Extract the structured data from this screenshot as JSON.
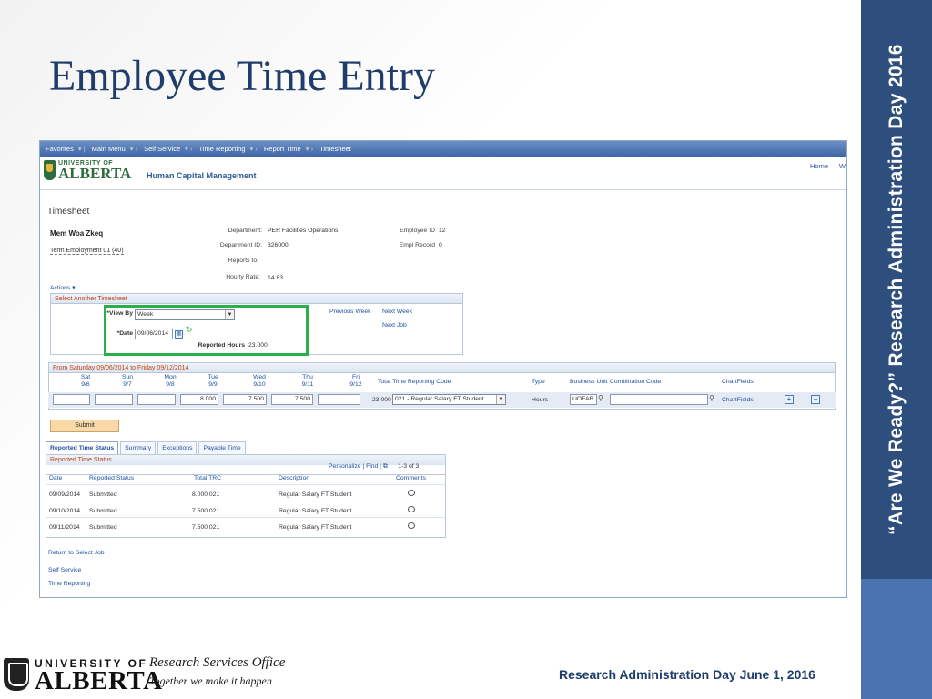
{
  "slide": {
    "title": "Employee Time Entry",
    "sidebar_text": "“Are We Ready?” Research Administration Day 2016",
    "footer_office": "Research Services Office",
    "footer_tagline": "Together we make it happen",
    "footer_event": "Research Administration Day June 1, 2016",
    "footer_logo_top": "UNIVERSITY OF",
    "footer_logo_bottom": "ALBERTA"
  },
  "nav": {
    "items": [
      "Favorites",
      "Main Menu",
      "Self Service",
      "Time Reporting",
      "Report Time",
      "Timesheet"
    ]
  },
  "banner": {
    "logo_top": "UNIVERSITY OF",
    "logo_bottom": "ALBERTA",
    "app_name": "Human Capital Management",
    "home": "Home",
    "w": "W"
  },
  "timesheet": {
    "title": "Timesheet",
    "employee_name": "Mem Woa Zkeq",
    "job": "Term Employment 01 (40)",
    "department_label": "Department:",
    "department_value": "PER Facilities Operations",
    "department_id_label": "Department ID:",
    "department_id_value": "326000",
    "reports_to_label": "Reports to:",
    "reports_to_value": "",
    "hourly_rate_label": "Hourly Rate:",
    "hourly_rate_value": "14.83",
    "employee_id_label": "Employee ID",
    "employee_id_value": "12",
    "empl_record_label": "Empl Record",
    "empl_record_value": "0",
    "actions": "Actions ▾"
  },
  "select_timesheet": {
    "header": "Select Another Timesheet",
    "view_by_label": "*View By",
    "view_by_value": "Week",
    "date_label": "*Date",
    "date_value": "09/06/2014",
    "reported_hours_label": "Reported Hours",
    "reported_hours_value": "23.000",
    "previous_week": "Previous Week",
    "next_week": "Next Week",
    "next_job": "Next Job"
  },
  "week_grid": {
    "header": "From Saturday 09/06/2014 to Friday 09/12/2014",
    "days": [
      {
        "day": "Sat",
        "date": "9/6",
        "value": ""
      },
      {
        "day": "Sun",
        "date": "9/7",
        "value": ""
      },
      {
        "day": "Mon",
        "date": "9/8",
        "value": ""
      },
      {
        "day": "Tue",
        "date": "9/9",
        "value": "8.000"
      },
      {
        "day": "Wed",
        "date": "9/10",
        "value": "7.500"
      },
      {
        "day": "Thu",
        "date": "9/11",
        "value": "7.500"
      },
      {
        "day": "Fri",
        "date": "9/12",
        "value": ""
      }
    ],
    "total_label": "Total",
    "trc_label": "Time Reporting Code",
    "type_label": "Type",
    "bu_label": "Business Unit",
    "combo_label": "Combination Code",
    "chartfields_label": "ChartFields",
    "total_value": "23.000",
    "trc_value": "021 - Regular Salary FT Student",
    "type_value": "Hours",
    "bu_value": "UOFAB",
    "combo_value": "",
    "chartfields_link": "ChartFields",
    "add": "+",
    "remove": "−"
  },
  "submit": "Submit",
  "tabs": [
    "Reported Time Status",
    "Summary",
    "Exceptions",
    "Payable Time"
  ],
  "status": {
    "header": "Reported Time Status",
    "personalize": "Personalize",
    "find": "Find",
    "count": "1-3 of 3",
    "columns": [
      "Date",
      "Reported Status",
      "Total TRC",
      "Description",
      "Comments"
    ],
    "rows": [
      {
        "date": "09/09/2014",
        "status": "Submitted",
        "trc": "8.000 021",
        "desc": "Regular Salary FT Student"
      },
      {
        "date": "09/10/2014",
        "status": "Submitted",
        "trc": "7.500 021",
        "desc": "Regular Salary FT Student"
      },
      {
        "date": "09/11/2014",
        "status": "Submitted",
        "trc": "7.500 021",
        "desc": "Regular Salary FT Student"
      }
    ]
  },
  "links": {
    "return": "Return to Select Job",
    "self_service": "Self Service",
    "time_reporting": "Time Reporting"
  }
}
